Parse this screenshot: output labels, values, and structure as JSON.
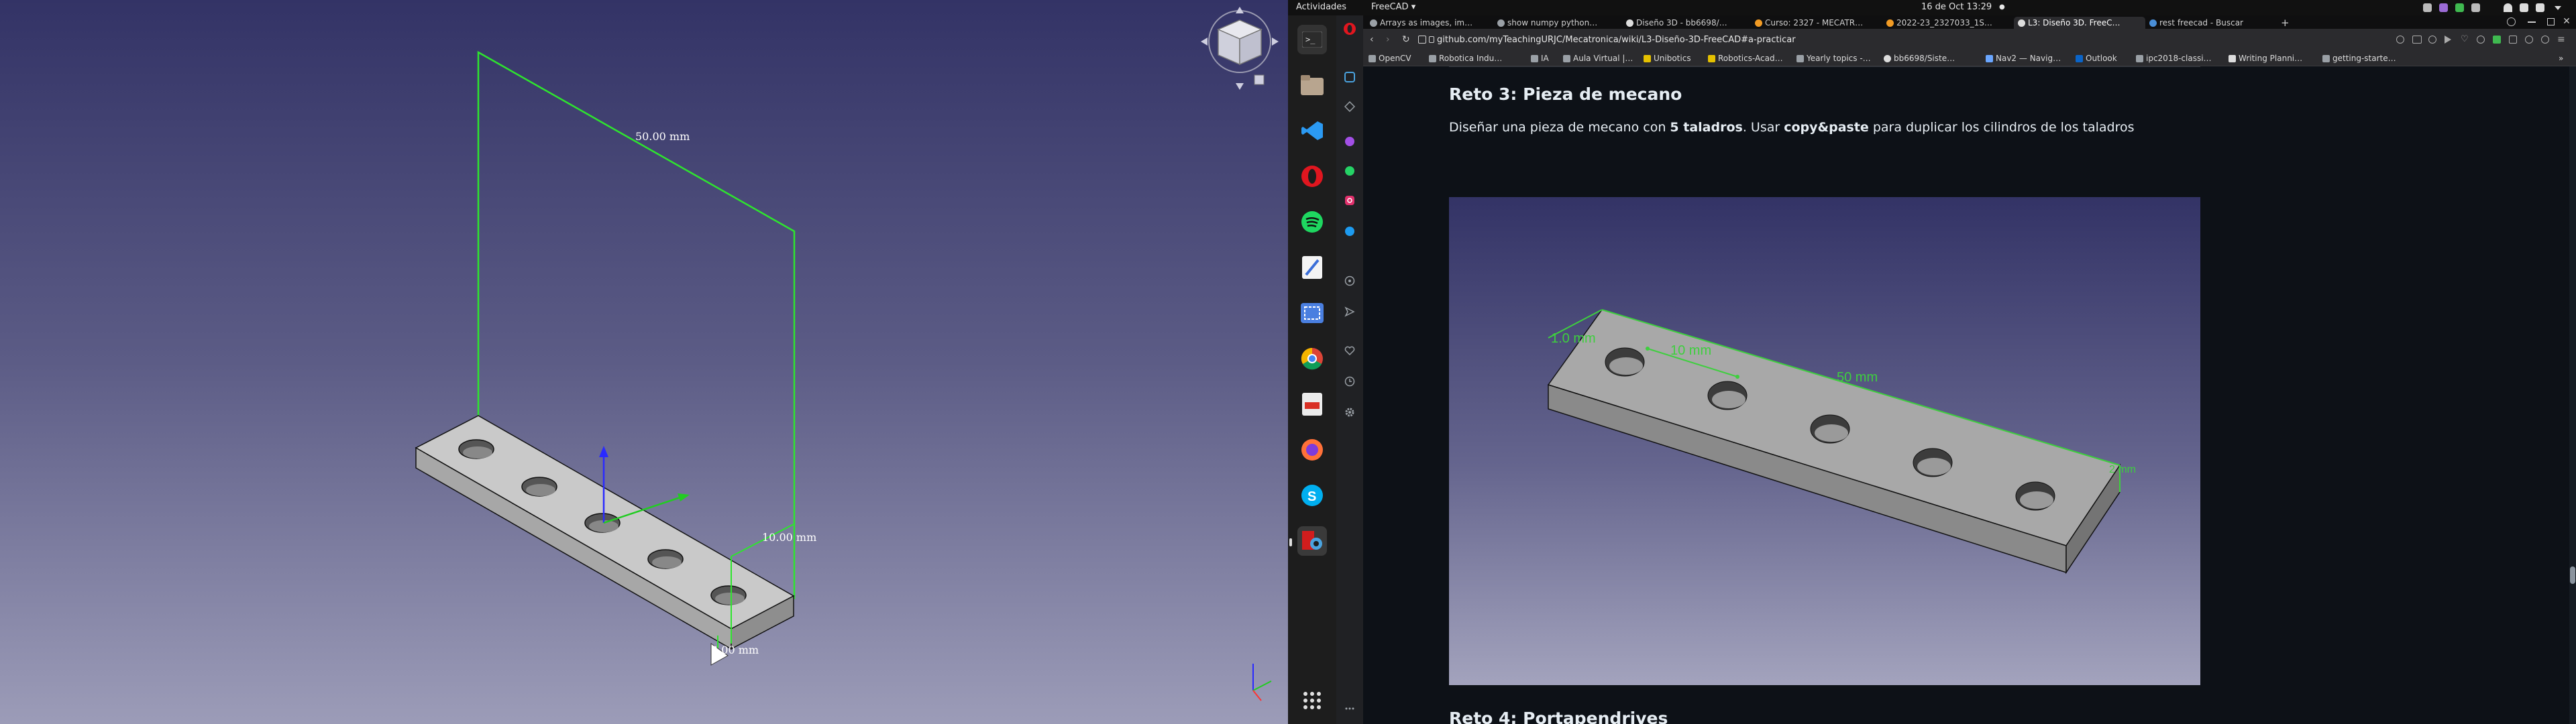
{
  "freecad": {
    "dim_height": "50.00 mm",
    "dim_width": "10.00 mm",
    "dim_thickness": "2.00 mm"
  },
  "topbar": {
    "activities": "Actividades",
    "app_menu": "FreeCAD ▾",
    "datetime": "16 de Oct  13:29",
    "dot": "●"
  },
  "browser": {
    "tabs": [
      {
        "label": "Arrays as images, im…"
      },
      {
        "label": "show numpy python…"
      },
      {
        "label": "Diseño 3D - bb6698/…"
      },
      {
        "label": "Curso: 2327 - MECATR…"
      },
      {
        "label": "2022-23_2327033_1S…"
      },
      {
        "label": "L3: Diseño 3D. FreeC…"
      },
      {
        "label": "rest freecad - Buscar"
      }
    ],
    "new_tab": "+",
    "url": "github.com/myTeachingURJC/Mecatronica/wiki/L3-Diseño-3D-FreeCAD#a-practicar",
    "bookmarks": [
      {
        "label": "OpenCV"
      },
      {
        "label": "Robotica Indu…"
      },
      {
        "label": "IA"
      },
      {
        "label": "Aula Virtual |…"
      },
      {
        "label": "Unibotics"
      },
      {
        "label": "Robotics-Acad…"
      },
      {
        "label": "Yearly topics -…"
      },
      {
        "label": "bb6698/Siste…"
      },
      {
        "label": "Nav2 — Navig…"
      },
      {
        "label": "Outlook"
      },
      {
        "label": "ipc2018-classi…"
      },
      {
        "label": "Writing Planni…"
      },
      {
        "label": "getting-starte…"
      }
    ],
    "bookmarks_more": "»"
  },
  "page": {
    "heading_reto3": "Reto 3: Pieza de mecano",
    "para_prefix": "Diseñar una pieza de mecano con ",
    "para_bold1": "5 taladros",
    "para_mid": ". Usar ",
    "para_bold2": "copy&paste",
    "para_suffix": " para duplicar los cilindros de los taladros",
    "fig_dim_a": "1.0 mm",
    "fig_dim_b": "10 mm",
    "fig_dim_c": "50 mm",
    "fig_dim_d": "2 mm",
    "heading_reto4": "Reto 4: Portapendrives"
  },
  "colors": {
    "dimension_green": "#3ecf3e",
    "github_bg": "#0d1117",
    "freecad_bg_top": "#333366"
  }
}
